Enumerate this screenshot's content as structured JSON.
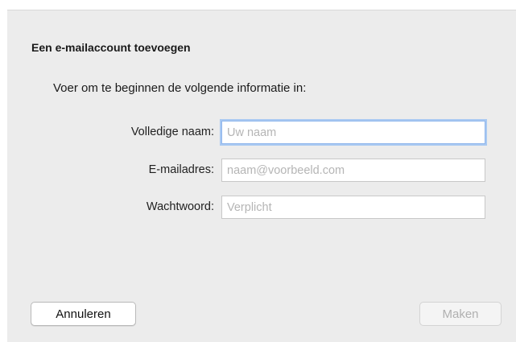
{
  "dialog": {
    "title": "Een e-mailaccount toevoegen",
    "subtitle": "Voer om te beginnen de volgende informatie in:"
  },
  "form": {
    "full_name": {
      "label": "Volledige naam:",
      "value": "",
      "placeholder": "Uw naam"
    },
    "email": {
      "label": "E-mailadres:",
      "value": "",
      "placeholder": "naam@voorbeeld.com"
    },
    "password": {
      "label": "Wachtwoord:",
      "value": "",
      "placeholder": "Verplicht"
    }
  },
  "buttons": {
    "cancel_label": "Annuleren",
    "create_label": "Maken"
  },
  "colors": {
    "focus_ring": "#a9c9f2",
    "sheet_background": "#ececec"
  }
}
